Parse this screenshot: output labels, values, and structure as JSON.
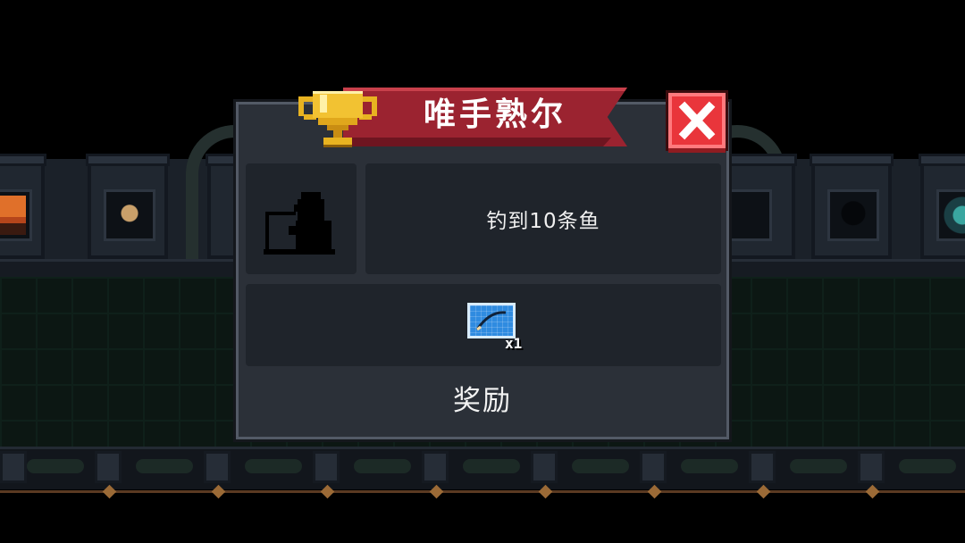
{
  "achievement": {
    "title": "唯手熟尔",
    "description": "钓到10条鱼",
    "icon": "fisherman-silhouette-icon",
    "locked": true
  },
  "reward": {
    "label": "奖励",
    "item_icon": "fishing-rod-blueprint-icon",
    "quantity": "x1"
  },
  "banner_icon": "gold-trophy-icon",
  "close_icon": "close-x-icon",
  "colors": {
    "dialog_bg": "#2b3038",
    "panel_bg": "#1f242b",
    "banner_red": "#9b2330",
    "close_red": "#e9353b",
    "trophy_gold": "#e8b321",
    "blueprint_blue": "#2f8be0"
  }
}
